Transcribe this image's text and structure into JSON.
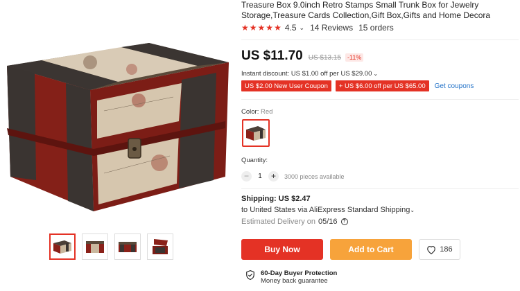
{
  "product": {
    "title": "Treasure Box 9.0inch Retro Stamps Small Trunk Box for Jewelry Storage,Treasure Cards Collection,Gift Box,Gifts and Home Decora",
    "rating": "4.5",
    "stars": 5,
    "reviews": "14 Reviews",
    "orders": "15 orders"
  },
  "price": {
    "current": "US $11.70",
    "original": "US $13.15",
    "discount": "-11%",
    "instant_discount": "Instant discount: US $1.00 off per US $29.00"
  },
  "coupons": [
    {
      "label": "US $2.00 New User Coupon"
    },
    {
      "label": "+ US $6.00 off per US $65.00"
    }
  ],
  "get_coupons": "Get coupons",
  "color": {
    "label": "Color: ",
    "value": "Red"
  },
  "quantity": {
    "label": "Quantity:",
    "value": "1",
    "minus": "−",
    "plus": "+",
    "available": "3000 pieces available"
  },
  "shipping": {
    "title": "Shipping: US $2.47",
    "to": "to United States via AliExpress Standard Shipping",
    "est_label": "Estimated Delivery on",
    "est_date": "05/16"
  },
  "actions": {
    "buy_now": "Buy Now",
    "add_to_cart": "Add to Cart",
    "wishlist_count": "186"
  },
  "protection": {
    "title": "60-Day Buyer Protection",
    "subtitle": "Money back guarantee"
  },
  "colors": {
    "accent": "#e43225",
    "cart": "#f7a33b",
    "link": "#2473c8"
  }
}
